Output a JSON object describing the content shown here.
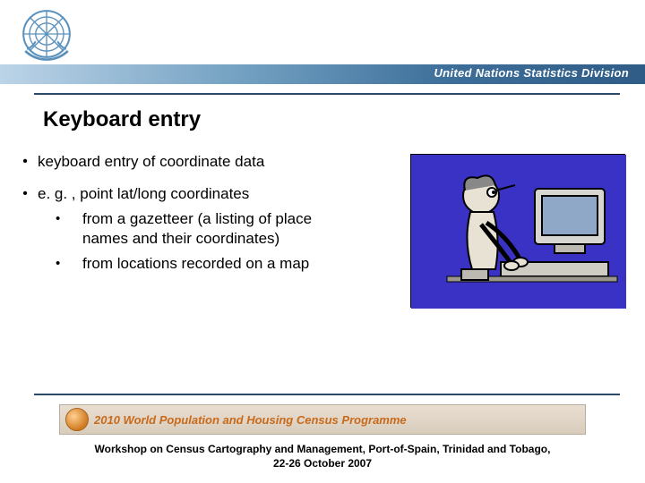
{
  "header": {
    "org_text": "United Nations Statistics Division",
    "logo_name": "un-logo"
  },
  "title": "Keyboard entry",
  "bullets": [
    {
      "text": "keyboard entry of coordinate data"
    },
    {
      "text": "e. g. , point lat/long coordinates",
      "sub": [
        "from a gazetteer (a listing of place names and their coordinates)",
        "from locations recorded on a map"
      ]
    }
  ],
  "illustration": {
    "name": "person-typing-computer-cartoon",
    "bg_color": "#3a32c4"
  },
  "footer_banner": "2010 World Population and Housing Census Programme",
  "footer_line1": "Workshop on Census Cartography and Management, Port-of-Spain, Trinidad and Tobago,",
  "footer_line2": "22-26 October 2007"
}
